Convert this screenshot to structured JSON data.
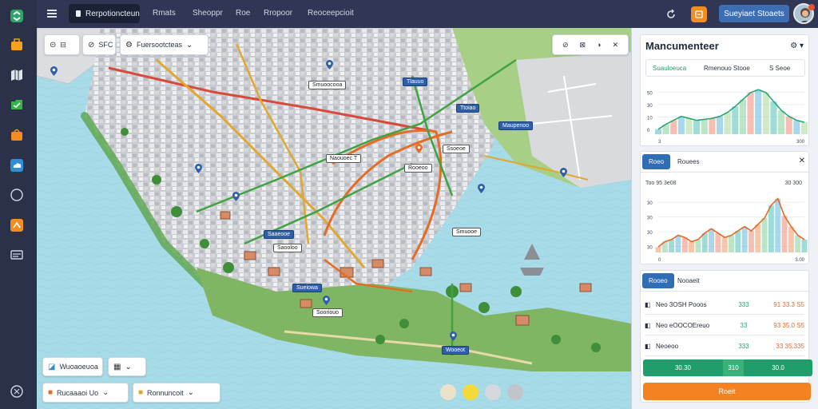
{
  "topbar": {
    "active_tab": "Rerpotioncteun",
    "links": [
      "Rmats",
      "Sheoppr",
      "Roe",
      "Rropoor",
      "Reoceepcioit"
    ],
    "primary_button": "Sueyiaet Stoaets"
  },
  "map_controls": {
    "toolbar_a": "SFC",
    "toolbar_b_label": "Fuersootcteas",
    "bottom_chip_1": "Wuoaoeuoa",
    "bottom_chip_2_icon": "grid-icon",
    "bottom_chip_3": "Rucaaaoi Uo",
    "bottom_chip_4": "Ronnuncoit"
  },
  "map_labels": [
    {
      "text": "Smuoocooa",
      "style": "white"
    },
    {
      "text": "Tlauuo",
      "style": "blue"
    },
    {
      "text": "Ttoiao",
      "style": "blue"
    },
    {
      "text": "Maupenoo",
      "style": "blue"
    },
    {
      "text": "Naouoec T",
      "style": "white"
    },
    {
      "text": "Ssoeoe",
      "style": "white"
    },
    {
      "text": "Rooeoo",
      "style": "white"
    },
    {
      "text": "Saaeooe",
      "style": "blue"
    },
    {
      "text": "Smuooe",
      "style": "white"
    },
    {
      "text": "Sooriouo",
      "style": "white"
    },
    {
      "text": "Sueiowa",
      "style": "blue"
    },
    {
      "text": "Wooeot",
      "style": "blue"
    },
    {
      "text": "Saooloo",
      "style": "white"
    }
  ],
  "panel": {
    "title": "Mancumenteer",
    "tabs1": [
      "Suauloeuca",
      "Rmenouo Stooe",
      "S Seoe"
    ],
    "chart1": {
      "ymax": "50",
      "x_left": "3",
      "x_right": "300"
    },
    "tabs2": [
      "Roeo",
      "Rouees"
    ],
    "chart2": {
      "ylabel_left": "Too 95 3e08",
      "ylabel_right": "30 300",
      "x_left": "0",
      "x_right": "3.00"
    },
    "tabs3": [
      "Rooeo",
      "Nooaeit"
    ],
    "rows": [
      {
        "label": "Neo 3OSH Pooos",
        "v1": "333",
        "v2": "91 33.3 S5"
      },
      {
        "label": "Neo eOOCOEreuo",
        "v1": "33",
        "v2": "93 35.0 S5"
      },
      {
        "label": "Neoeoo",
        "v1": "333",
        "v2": "33 35.335"
      }
    ],
    "green_bar": {
      "left": "30.30",
      "mid": "310",
      "right": "30.0"
    },
    "orange_button": "Roeit"
  },
  "chart_data": [
    {
      "type": "area",
      "title": "",
      "x": [
        0,
        1,
        2,
        3,
        4,
        5,
        6,
        7,
        8,
        9,
        10,
        11,
        12,
        13,
        14,
        15,
        16,
        17,
        18,
        19
      ],
      "values": [
        5,
        10,
        14,
        18,
        16,
        14,
        15,
        16,
        18,
        22,
        28,
        35,
        42,
        45,
        42,
        33,
        24,
        18,
        14,
        12
      ],
      "ylim": [
        0,
        50
      ]
    },
    {
      "type": "area",
      "title": "",
      "x": [
        0,
        1,
        2,
        3,
        4,
        5,
        6,
        7,
        8,
        9,
        10,
        11,
        12,
        13,
        14,
        15,
        16,
        17,
        18,
        19,
        20,
        21,
        22
      ],
      "values": [
        5,
        10,
        12,
        16,
        14,
        10,
        12,
        18,
        22,
        18,
        14,
        16,
        20,
        24,
        20,
        26,
        32,
        44,
        50,
        34,
        24,
        16,
        12
      ],
      "ylim": [
        0,
        55
      ]
    }
  ],
  "colors": {
    "accent": "#2f6db5",
    "orange": "#f58220",
    "green": "#1f9d6a",
    "rail": "#2a3148"
  }
}
